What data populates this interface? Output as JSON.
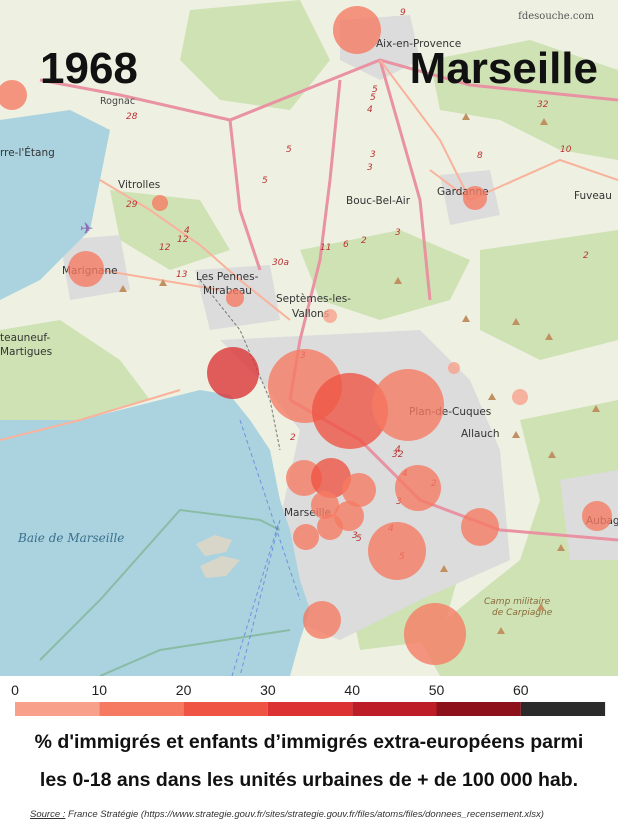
{
  "header": {
    "year": "1968",
    "city": "Marseille",
    "watermark": "fdesouche.com"
  },
  "map": {
    "places": [
      "Aix-en-Provence",
      "rre-l'Étang",
      "Rognac",
      "Vitrolles",
      "Bouc-Bel-Air",
      "Gardanne",
      "Fuveau",
      "Marignane",
      "Les Pennes-",
      "Mirabeau",
      "Septèmes-les-",
      "Vallons",
      "teauneuf-",
      "Martigues",
      "Plan-de-Cuques",
      "Allauch",
      "Marseille",
      "Aubag"
    ],
    "water_label": "Baie de Marseille",
    "military_area": [
      "Camp militaire",
      "de Carpiagne"
    ],
    "road_numbers": [
      "9",
      "5",
      "4",
      "5",
      "28",
      "32",
      "10",
      "8",
      "3",
      "5",
      "3",
      "29",
      "5",
      "6",
      "2",
      "3",
      "4",
      "12",
      "12",
      "13",
      "30a",
      "11",
      "3",
      "2",
      "32",
      "4",
      "3",
      "4",
      "5",
      "2",
      "5",
      "4",
      "3",
      "2",
      "A"
    ]
  },
  "colors": {
    "land": "#eef0e2",
    "forest": "#cfe2b4",
    "urban": "#dcdcdc",
    "water": "#aad3df",
    "motorway": "#e892a2",
    "trunk": "#f9b29c",
    "bubble_scale": [
      "#f9a08a",
      "#f67a62",
      "#ef5343",
      "#dc3233",
      "#bd1d27",
      "#8c111a",
      "#2b2b2b"
    ]
  },
  "chart_data": {
    "type": "scatter",
    "encoding": "bubble map: circle colour = % class, circle size = population",
    "scale": {
      "ticks": [
        "0",
        "10",
        "20",
        "30",
        "40",
        "50",
        "60"
      ],
      "bins": [
        0,
        10,
        20,
        30,
        40,
        50,
        60,
        70
      ]
    },
    "points": [
      {
        "place": "Aix-en-Provence",
        "value": 15
      },
      {
        "place": "Berre-l'Étang",
        "value": 18
      },
      {
        "place": "Vitrolles",
        "value": 12
      },
      {
        "place": "Marignane",
        "value": 18
      },
      {
        "place": "Les Pennes-Mirabeau",
        "value": 12
      },
      {
        "place": "Septèmes-les-Vallons",
        "value": 8
      },
      {
        "place": "Gardanne",
        "value": 18
      },
      {
        "place": "Marseille 16e",
        "value": 30
      },
      {
        "place": "Marseille 15e",
        "value": 14
      },
      {
        "place": "Marseille 14e",
        "value": 22
      },
      {
        "place": "Marseille 13e",
        "value": 15
      },
      {
        "place": "Plan-de-Cuques",
        "value": 8
      },
      {
        "place": "Allauch",
        "value": 8
      },
      {
        "place": "Marseille 3e",
        "value": 18
      },
      {
        "place": "Marseille 2e",
        "value": 20
      },
      {
        "place": "Marseille 1er",
        "value": 16
      },
      {
        "place": "Marseille 4e",
        "value": 12
      },
      {
        "place": "Marseille 12e",
        "value": 16
      },
      {
        "place": "Marseille 5e",
        "value": 14
      },
      {
        "place": "Marseille 6e",
        "value": 14
      },
      {
        "place": "Marseille 7e",
        "value": 10
      },
      {
        "place": "Marseille 10e",
        "value": 15
      },
      {
        "place": "Marseille 11e",
        "value": 16
      },
      {
        "place": "Marseille 9e",
        "value": 14
      },
      {
        "place": "Marseille 8e",
        "value": 12
      },
      {
        "place": "Aubagne",
        "value": 12
      }
    ]
  },
  "caption": {
    "line1": "% d'immigrés et enfants d’immigrés extra-européens parmi",
    "line2": "les 0-18 ans dans les unités urbaines de + de 100 000 hab."
  },
  "source": {
    "label": "Source :",
    "text": " France Stratégie (https://www.strategie.gouv.fr/sites/strategie.gouv.fr/files/atoms/files/donnees_recensement.xlsx)"
  }
}
